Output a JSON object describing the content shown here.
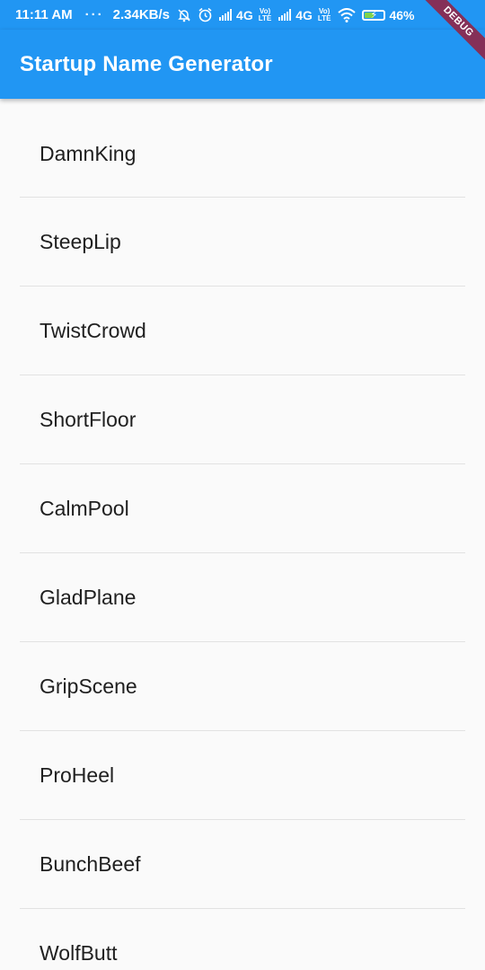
{
  "status_bar": {
    "time": "11:11 AM",
    "overflow": "···",
    "speed": "2.34KB/s",
    "network_1": "4G",
    "volte_1": [
      "Vo)",
      "LTE"
    ],
    "network_2": "4G",
    "volte_2": [
      "Vo)",
      "LTE"
    ],
    "battery": "46%",
    "icons": [
      "mute-bell-icon",
      "alarm-icon",
      "signal-icon",
      "wifi-icon",
      "battery-charging-icon"
    ]
  },
  "app_bar": {
    "title": "Startup Name Generator",
    "color": "#2196F3"
  },
  "debug_banner": "DEBUG",
  "list": {
    "items": [
      "DamnKing",
      "SteepLip",
      "TwistCrowd",
      "ShortFloor",
      "CalmPool",
      "GladPlane",
      "GripScene",
      "ProHeel",
      "BunchBeef",
      "WolfButt"
    ]
  }
}
